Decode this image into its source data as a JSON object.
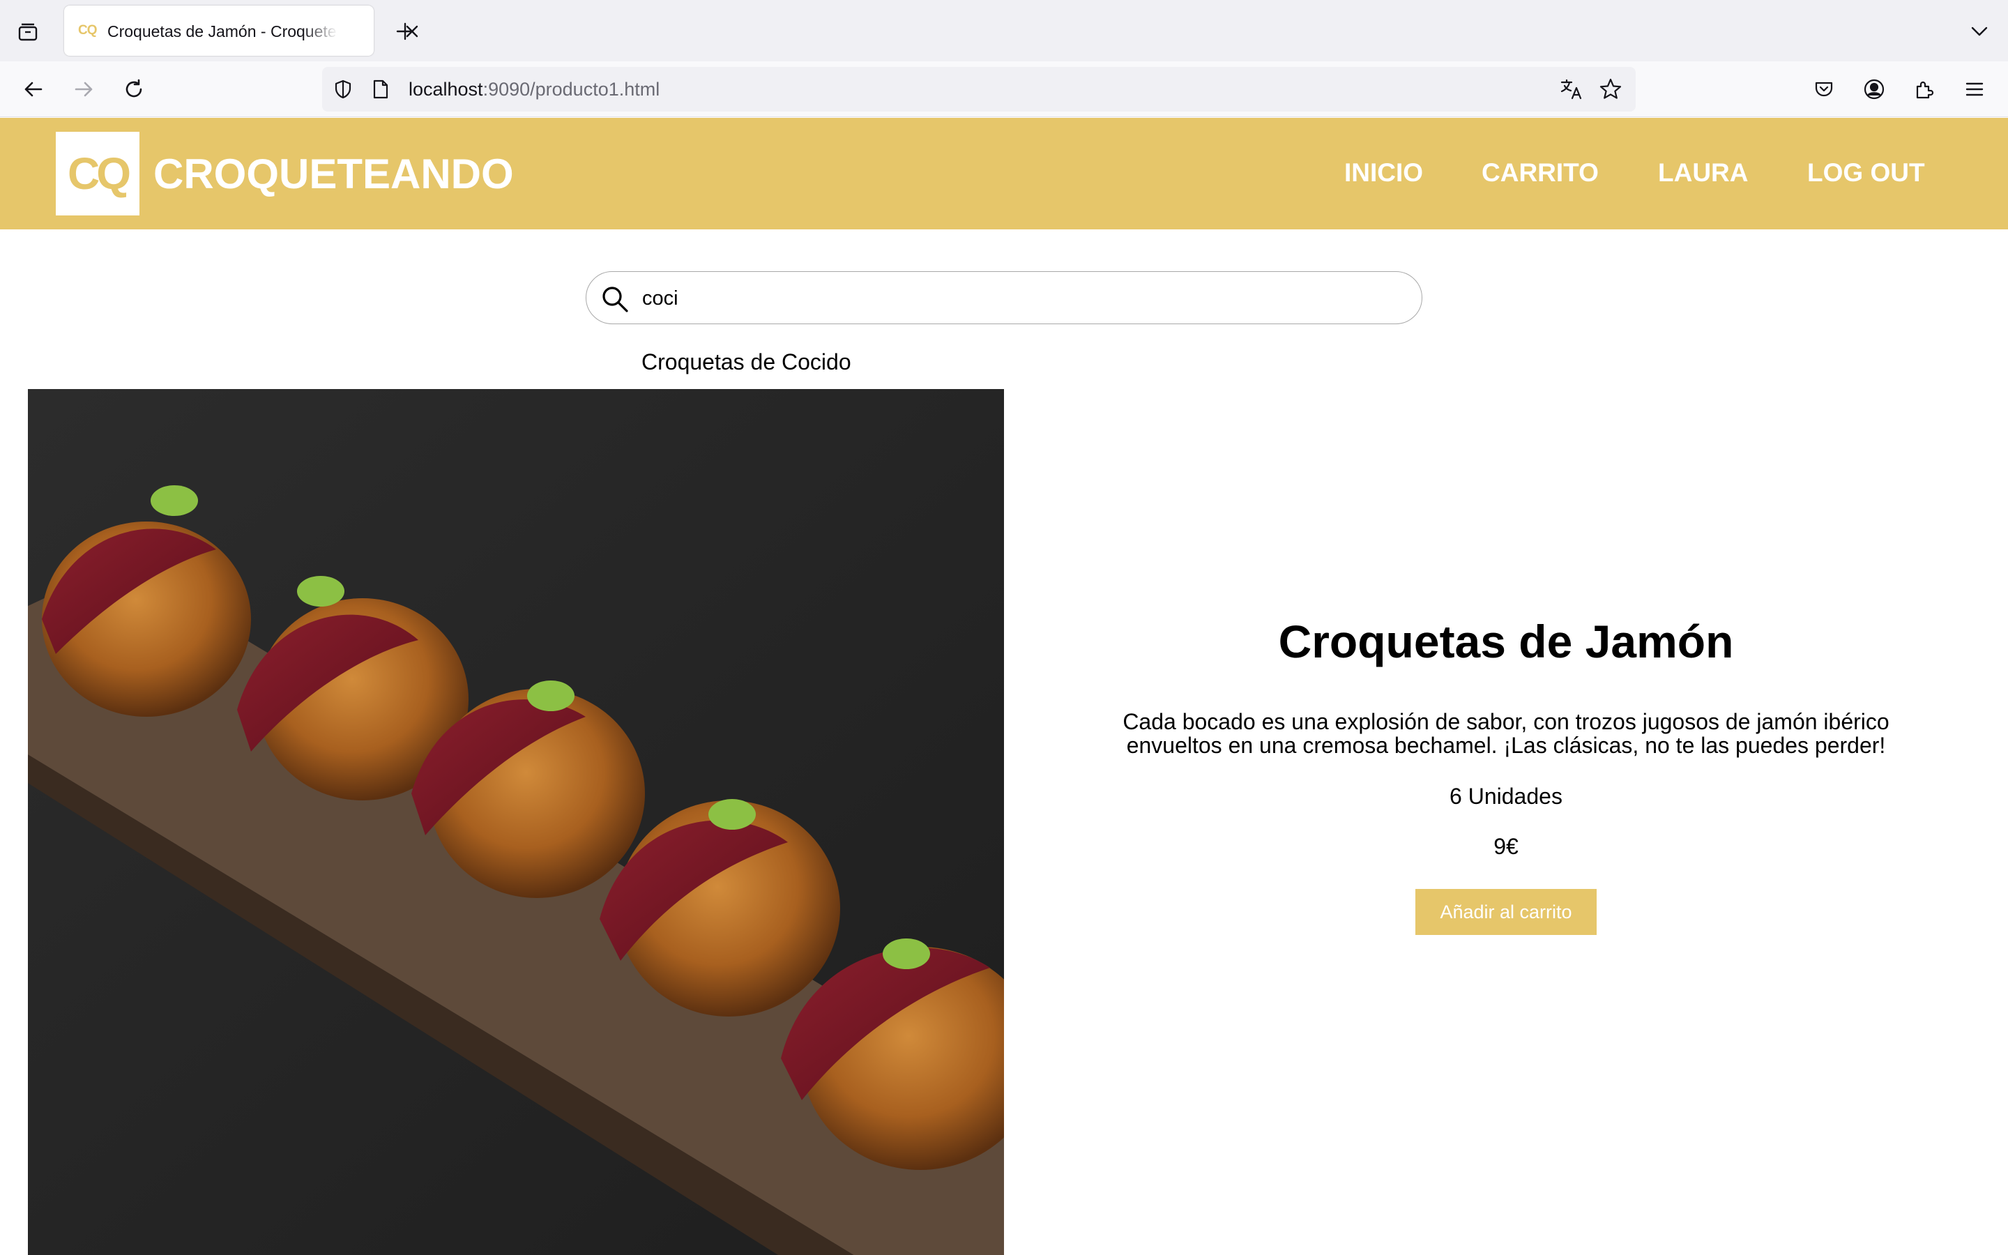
{
  "browser": {
    "tab_title": "Croquetas de Jamón - Croqueteando",
    "url_host": "localhost",
    "url_rest": ":9090/producto1.html"
  },
  "site": {
    "logo_letters": "CQ",
    "brand": "CROQUETEANDO",
    "nav": [
      "INICIO",
      "CARRITO",
      "LAURA",
      "LOG OUT"
    ],
    "accent_color": "#e6c66a"
  },
  "search": {
    "value": "coci",
    "suggestions": [
      "Croquetas de Cocido"
    ]
  },
  "product": {
    "title": "Croquetas de Jamón",
    "description": "Cada bocado es una explosión de sabor, con trozos jugosos de jamón ibérico envueltos en una cremosa bechamel. ¡Las clásicas, no te las puedes perder!",
    "units": "6 Unidades",
    "price": "9€",
    "add_button": "Añadir al carrito"
  }
}
